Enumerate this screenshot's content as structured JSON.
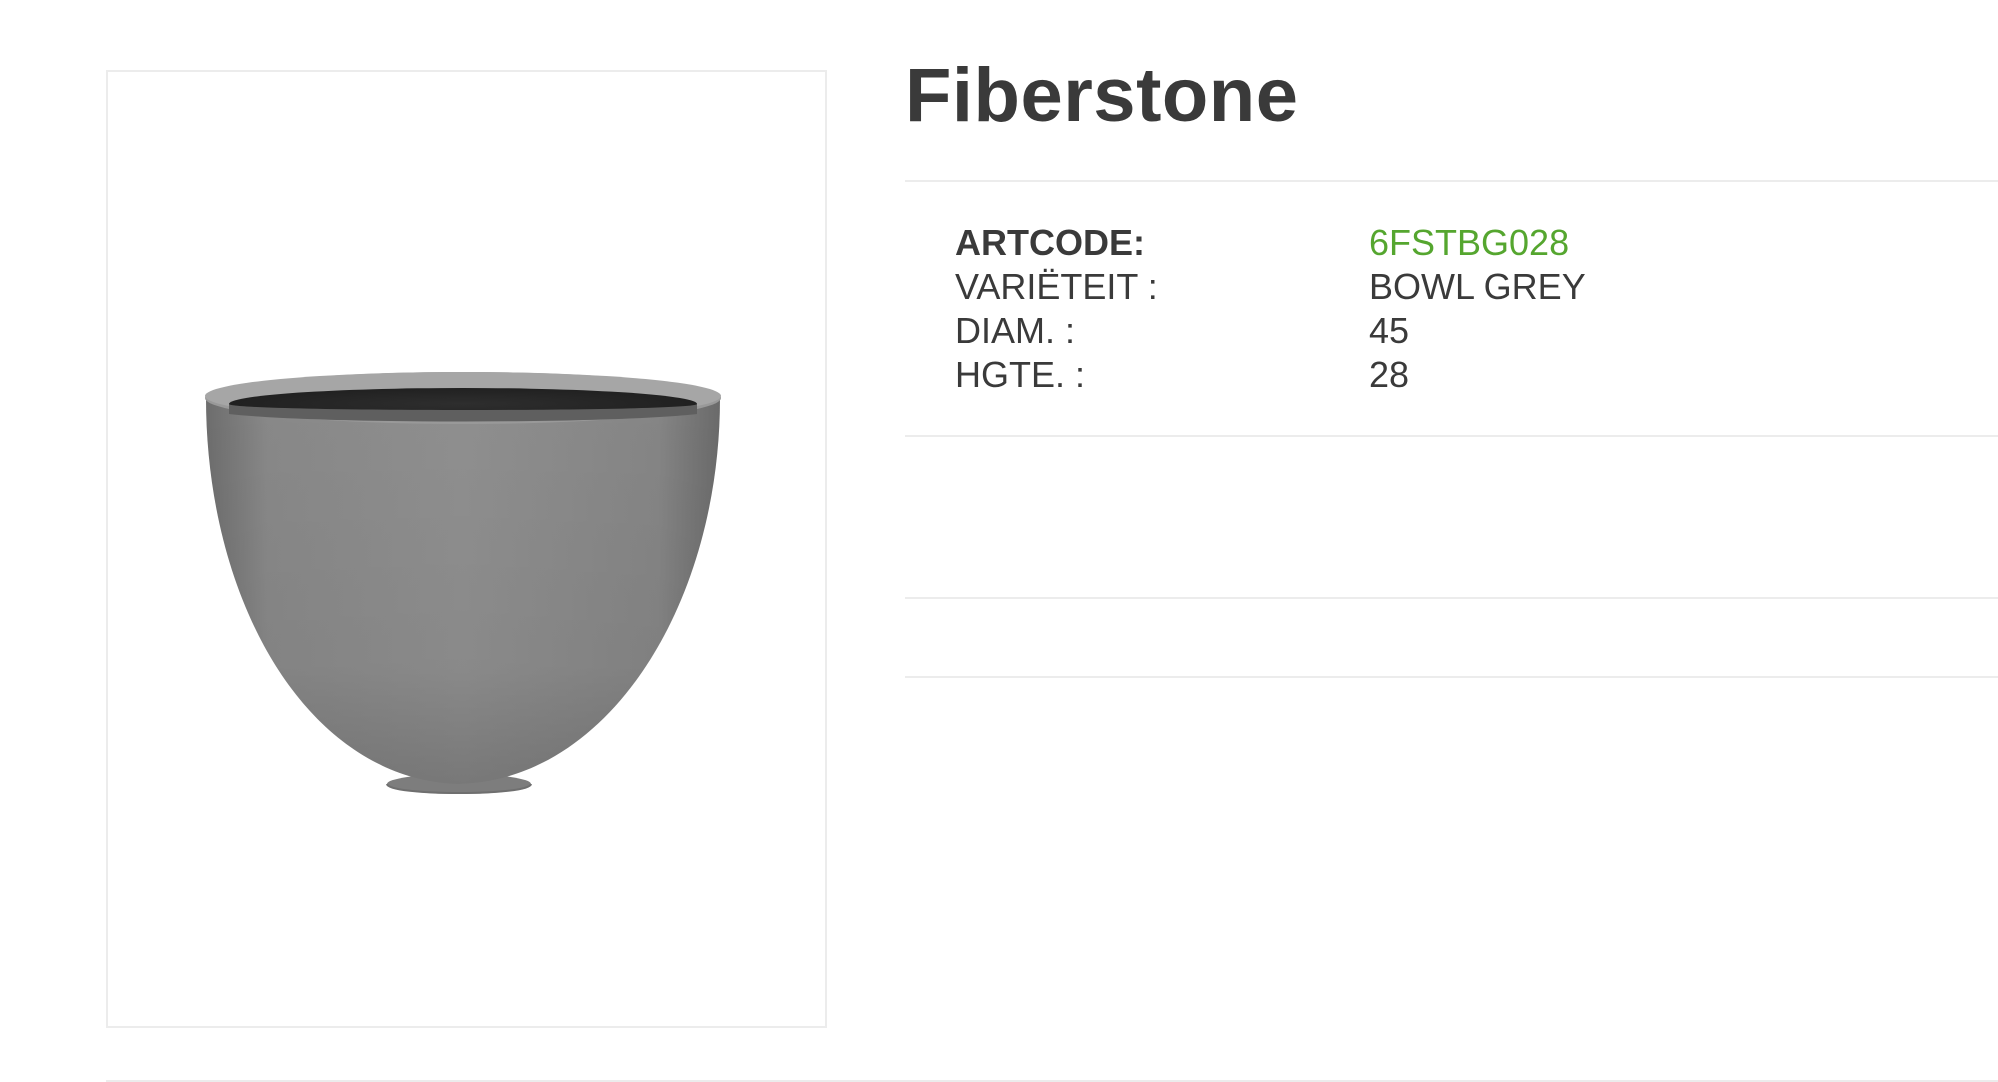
{
  "product": {
    "title": "Fiberstone",
    "image_alt": "Grey fiberstone bowl planter"
  },
  "specs": {
    "artcode": {
      "label": "ARTCODE:",
      "value": "6FSTBG028"
    },
    "variety": {
      "label": "VARIËTEIT :",
      "value": "BOWL GREY"
    },
    "diameter": {
      "label": "DIAM. :",
      "value": "45"
    },
    "height": {
      "label": "HGTE. :",
      "value": "28"
    }
  },
  "colors": {
    "accent": "#55a62f",
    "text": "#3a3a3a",
    "divider": "#ececec"
  }
}
